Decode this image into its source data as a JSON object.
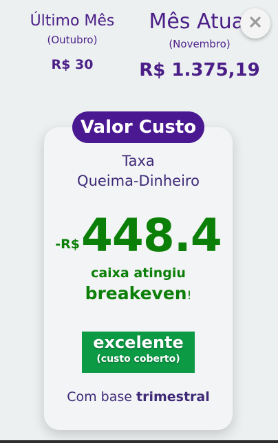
{
  "comparison": {
    "last_month": {
      "label": "Último Mês",
      "month": "(Outubro)",
      "amount": "R$ 30"
    },
    "current_month": {
      "label": "Mês Atual",
      "month": "(Novembro)",
      "amount": "R$ 1.375,19"
    }
  },
  "close_button": {
    "icon": "close-icon"
  },
  "card": {
    "pill_label": "Valor Custo",
    "metric_line1": "Taxa",
    "metric_line2": "Queima-Dinheiro",
    "value_prefix": "-R$",
    "value": "448.4",
    "status_line1": "caixa atingiu",
    "status_line2": "breakeven",
    "status_mark": "!",
    "badge_title": "excelente",
    "badge_subtitle": "(custo coberto)",
    "basis_prefix": "Com base ",
    "basis_strong": "trimestral"
  },
  "colors": {
    "purple": "#4a1891",
    "green": "#0b7f07",
    "badge_green": "#0c9a45",
    "background": "#ecf0f1"
  }
}
